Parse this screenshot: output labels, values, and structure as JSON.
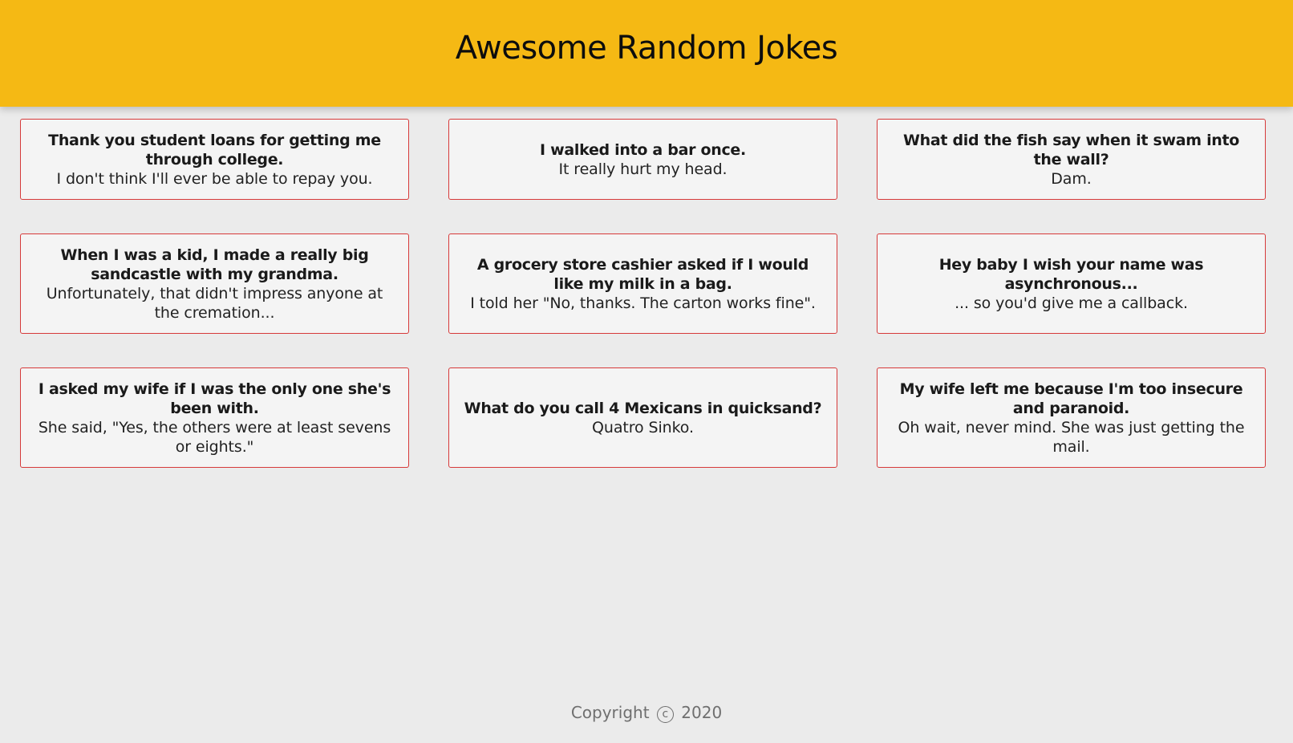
{
  "header": {
    "title": "Awesome Random Jokes",
    "background_color": "#f5b914"
  },
  "jokes": [
    {
      "setup": "Thank you student loans for getting me through college.",
      "punchline": "I don't think I'll ever be able to repay you."
    },
    {
      "setup": "I walked into a bar once.",
      "punchline": "It really hurt my head."
    },
    {
      "setup": "What did the fish say when it swam into the wall?",
      "punchline": "Dam."
    },
    {
      "setup": "When I was a kid, I made a really big sandcastle with my grandma.",
      "punchline": "Unfortunately, that didn't impress anyone at the cremation..."
    },
    {
      "setup": "A grocery store cashier asked if I would like my milk in a bag.",
      "punchline": "I told her \"No, thanks. The carton works fine\"."
    },
    {
      "setup": "Hey baby I wish your name was asynchronous...",
      "punchline": "... so you'd give me a callback."
    },
    {
      "setup": "I asked my wife if I was the only one she's been with.",
      "punchline": "She said, \"Yes, the others were at least sevens or eights.\""
    },
    {
      "setup": "What do you call 4 Mexicans in quicksand?",
      "punchline": "Quatro Sinko."
    },
    {
      "setup": "My wife left me because I'm too insecure and paranoid.",
      "punchline": "Oh wait, never mind. She was just getting the mail."
    }
  ],
  "footer": {
    "copyright_label": "Copyright",
    "copyright_symbol": "c",
    "year": "2020"
  },
  "colors": {
    "page_background": "#ebebeb",
    "card_background": "#f4f4f4",
    "card_border": "#d63a3a",
    "footer_text": "#6f6f6f"
  }
}
